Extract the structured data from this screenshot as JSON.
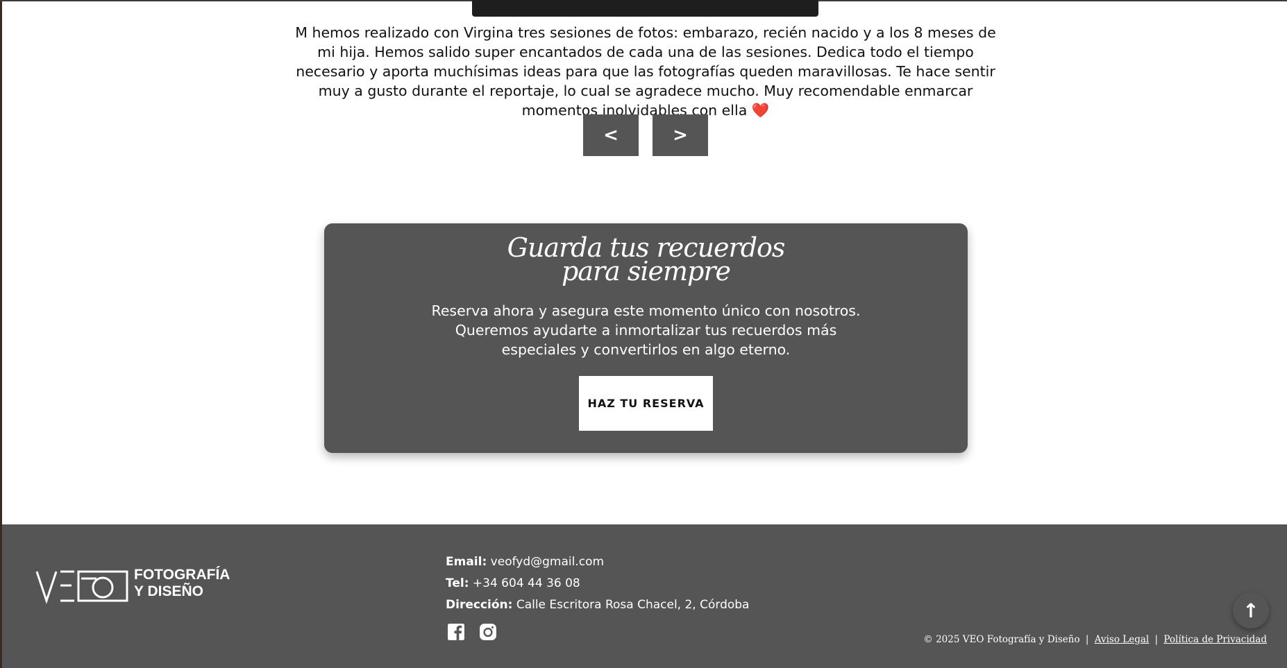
{
  "testimonial": {
    "text": "M hemos realizado con Virgina tres sesiones de fotos: embarazo, recién nacido y a los 8 meses de mi hija. Hemos salido super encantados de cada una de las sesiones. Dedica todo el tiempo necesario y aporta muchísimas ideas para que las fotografías queden maravillosas. Te hace sentir muy a gusto durante el reportaje, lo cual se agradece mucho. Muy recomendable enmarcar momentos inolvidables con ella",
    "heart": "❤️"
  },
  "carousel": {
    "prev_label": "<",
    "next_label": ">"
  },
  "cta": {
    "title_line1": "Guarda tus recuerdos",
    "title_line2": "para siempre",
    "text": "Reserva ahora y asegura este momento único con nosotros. Queremos ayudarte a inmortalizar tus recuerdos más especiales y convertirlos en algo eterno.",
    "button_label": "HAZ TU RESERVA"
  },
  "footer": {
    "logo_text_line1": "FOTOGRAFÍA",
    "logo_text_line2": "Y DISEÑO",
    "email_label": "Email:",
    "email": "veofyd@gmail.com",
    "tel_label": "Tel:",
    "tel": "+34 604 44 36 08",
    "address_label": "Dirección:",
    "address": "Calle Escritora Rosa Chacel, 2, Córdoba",
    "social": [
      "facebook-icon",
      "instagram-icon"
    ],
    "copyright": "© 2025 VEO Fotografía y Diseño",
    "separator": "|",
    "legal_link": "Aviso Legal",
    "privacy_link": "Política de Privacidad"
  },
  "scroll_top": {
    "label": "↑"
  },
  "colors": {
    "panel": "#555555",
    "heart": "#e0142c",
    "top_bar": "#1e1e1e"
  }
}
